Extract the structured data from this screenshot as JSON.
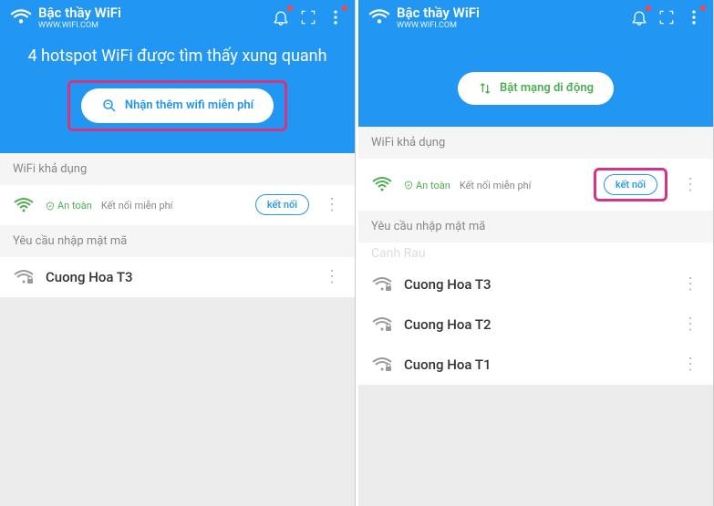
{
  "common": {
    "app_title": "Bậc thầy WiFi",
    "app_subtitle": "WWW.WIFI.COM",
    "section_available": "WiFi khả dụng",
    "section_password": "Yêu cầu nhập mật mã",
    "connect_label": "kết nối",
    "safe_label": "An toàn",
    "free_label": "Kết nối miễn phí"
  },
  "left": {
    "hero_title": "4 hotspot WiFi được tìm thấy xung quanh",
    "pill_label": "Nhận thêm wifi miễn phí",
    "password_items": [
      {
        "name": "Cuong Hoa T3"
      }
    ]
  },
  "right": {
    "pill_label": "Bật mạng di động",
    "watermark": "Canh Rau",
    "password_items": [
      {
        "name": "Cuong Hoa T3"
      },
      {
        "name": "Cuong Hoa T2"
      },
      {
        "name": "Cuong Hoa T1"
      }
    ]
  }
}
